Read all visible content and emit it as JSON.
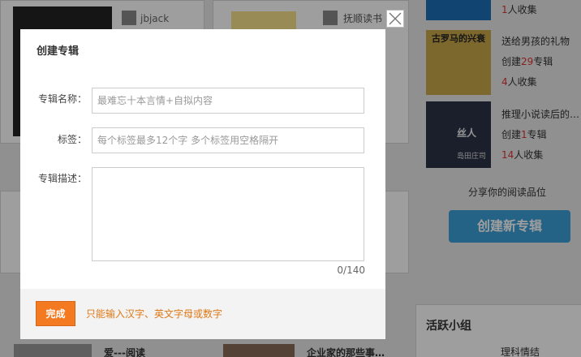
{
  "background": {
    "top_user": "jbjack",
    "top_book": "抚顺读书",
    "side_albums": [
      {
        "title": "",
        "creator_prefix": "",
        "creator_count": "",
        "creator_suffix": "",
        "collect_count": "1",
        "collect_suffix": "人收集"
      },
      {
        "title": "送给男孩的礼物",
        "creator_prefix": "创建",
        "creator_count": "29",
        "creator_suffix": "专辑",
        "collect_count": "4",
        "collect_suffix": "人收集"
      },
      {
        "title": "推理小说读后的…",
        "creator_prefix": "创建",
        "creator_count": "1",
        "creator_suffix": "专辑",
        "collect_count": "14",
        "collect_suffix": "人收集"
      }
    ],
    "covers": {
      "cover2_title": "古罗马的兴衰",
      "cover3_title": "丝人",
      "cover3_sub": "岛田庄司"
    },
    "share_text": "分享你的阅读品位",
    "create_album_label": "创建新专辑",
    "active_groups_title": "活跃小组",
    "group_item": "理科情结",
    "bottom_items": [
      "爱---阅读",
      "企业家的那些事…"
    ]
  },
  "dialog": {
    "title": "创建专辑",
    "name_label": "专辑名称：",
    "name_placeholder": "最难忘十本言情+自拟内容",
    "tag_label": "标签：",
    "tag_placeholder": "每个标签最多12个字 多个标签用空格隔开",
    "desc_label": "专辑描述：",
    "desc_value": "",
    "counter": "0/140",
    "submit_label": "完成",
    "hint": "只能输入汉字、英文字母或数字"
  },
  "colors": {
    "accent": "#f47a22",
    "hint": "#e07815",
    "blue_button": "#3a9ed8",
    "count_red": "#dd3333"
  }
}
